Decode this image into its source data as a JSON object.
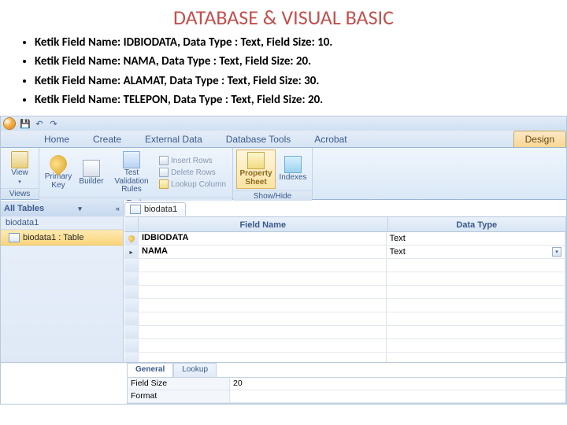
{
  "slide": {
    "title": "DATABASE & VISUAL BASIC",
    "bullets": [
      "Ketik Field Name: IDBIODATA, Data Type : Text, Field Size: 10.",
      "Ketik Field Name: NAMA, Data Type : Text, Field Size: 20.",
      "Ketik Field Name: ALAMAT, Data Type : Text, Field Size: 30.",
      "Ketik Field Name: TELEPON, Data Type : Text, Field Size: 20."
    ]
  },
  "tabs": {
    "home": "Home",
    "create": "Create",
    "ext": "External Data",
    "dbtools": "Database Tools",
    "acrobat": "Acrobat",
    "design": "Design"
  },
  "ribbon": {
    "view": "View",
    "views_grp": "Views",
    "pkey": "Primary Key",
    "builder": "Builder",
    "testvr": "Test Validation Rules",
    "insrows": "Insert Rows",
    "delrows": "Delete Rows",
    "lookupcol": "Lookup Column",
    "tools_grp": "Tools",
    "propsheet": "Property Sheet",
    "indexes": "Indexes",
    "showhide_grp": "Show/Hide"
  },
  "nav": {
    "head": "All Tables",
    "collapse": "«",
    "section": "biodata1",
    "item": "biodata1 : Table"
  },
  "doc": {
    "tab": "biodata1"
  },
  "grid": {
    "head_fn": "Field Name",
    "head_dt": "Data Type",
    "rows": [
      {
        "key": true,
        "fn": "IDBIODATA",
        "dt": "Text",
        "active": false
      },
      {
        "key": false,
        "fn": "NAMA",
        "dt": "Text",
        "active": true
      }
    ]
  },
  "props": {
    "tab_general": "General",
    "tab_lookup": "Lookup",
    "rows": [
      {
        "k": "Field Size",
        "v": "20"
      },
      {
        "k": "Format",
        "v": ""
      }
    ]
  }
}
